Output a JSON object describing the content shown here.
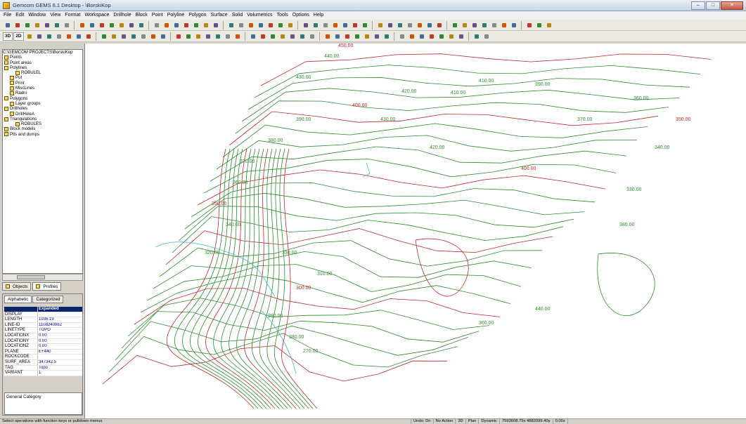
{
  "window": {
    "title": "Gemcom GEMS 6.1 Desktop - \\BorskiKop"
  },
  "menu": [
    "File",
    "Edit",
    "Window",
    "View",
    "Format",
    "Workspace",
    "Drillhole",
    "Block",
    "Point",
    "Polyline",
    "Polygon",
    "Surface",
    "Solid",
    "Volumetrics",
    "Tools",
    "Options",
    "Help"
  ],
  "toolbar2": {
    "view3d": "3D",
    "view2d": "2D"
  },
  "tree": {
    "root": "C:\\GEMCOM PROJECTS\\BorskiKop",
    "items": [
      {
        "label": "Points",
        "indent": 0
      },
      {
        "label": "Point areas",
        "indent": 0
      },
      {
        "label": "Polylines",
        "indent": 0
      },
      {
        "label": "ROBULEL",
        "indent": 2
      },
      {
        "label": "Put",
        "indent": 1
      },
      {
        "label": "Print",
        "indent": 1
      },
      {
        "label": "MiscLines",
        "indent": 1
      },
      {
        "label": "Radni",
        "indent": 1
      },
      {
        "label": "Polygons",
        "indent": 0
      },
      {
        "label": "Layer groups",
        "indent": 1
      },
      {
        "label": "Drillholes",
        "indent": 0
      },
      {
        "label": "DrillHoleA",
        "indent": 1
      },
      {
        "label": "Triangulations",
        "indent": 0
      },
      {
        "label": "ROBULES",
        "indent": 2
      },
      {
        "label": "Block models",
        "indent": 0
      },
      {
        "label": "Pits and dumps",
        "indent": 0
      }
    ]
  },
  "panel_tabs": {
    "objects": "Objects",
    "profiles": "Profiles"
  },
  "props_tabs": {
    "alphabetic": "Alphabetic",
    "categorized": "Categorized"
  },
  "props": [
    {
      "key": "",
      "value": "Expanded"
    },
    {
      "key": "DISPLAY",
      "value": ""
    },
    {
      "key": "LENGTH",
      "value": "1936.19"
    },
    {
      "key": "LINE-ID",
      "value": "1108240882"
    },
    {
      "key": "LINETYPE",
      "value": "TOPO"
    },
    {
      "key": "LOCATIONX",
      "value": "0.00"
    },
    {
      "key": "LOCATIONY",
      "value": "0.00"
    },
    {
      "key": "LOCATIONZ",
      "value": "0.00"
    },
    {
      "key": "PLANE",
      "value": "E+440"
    },
    {
      "key": "ROCKCODE",
      "value": ""
    },
    {
      "key": "SURF_AREA",
      "value": "347342.5"
    },
    {
      "key": "TAG",
      "value": "Topo"
    },
    {
      "key": "VARIANT",
      "value": "1"
    }
  ],
  "props_desc": "General Category",
  "status": {
    "message": "Select operations with function keys or pulldown menus",
    "undo": "Undo: Dn",
    "action": "No Action",
    "mode3d": "3D",
    "plan": "Plan",
    "dynamic": "Dynamic",
    "coords": "7593608.79x  4882099.40y",
    "z": "0.00z"
  },
  "contour_labels": [
    {
      "t": "450.00",
      "c": "red"
    },
    {
      "t": "440.00",
      "c": "green"
    },
    {
      "t": "430.00",
      "c": "green"
    },
    {
      "t": "420.00",
      "c": "green"
    },
    {
      "t": "410.00",
      "c": "green"
    },
    {
      "t": "400.00",
      "c": "red"
    },
    {
      "t": "390.00",
      "c": "green"
    },
    {
      "t": "380.00",
      "c": "green"
    },
    {
      "t": "370.00",
      "c": "green"
    },
    {
      "t": "360.00",
      "c": "green"
    },
    {
      "t": "350.00",
      "c": "red"
    },
    {
      "t": "340.00",
      "c": "green"
    },
    {
      "t": "330.00",
      "c": "green"
    },
    {
      "t": "320.00",
      "c": "green"
    },
    {
      "t": "310.00",
      "c": "green"
    },
    {
      "t": "300.00",
      "c": "red"
    },
    {
      "t": "290.00",
      "c": "green"
    },
    {
      "t": "280.00",
      "c": "green"
    },
    {
      "t": "270.00",
      "c": "green"
    },
    {
      "t": "410.00",
      "c": "green"
    },
    {
      "t": "390.00",
      "c": "green"
    },
    {
      "t": "370.00",
      "c": "green"
    },
    {
      "t": "360.00",
      "c": "green"
    },
    {
      "t": "350.00",
      "c": "red"
    },
    {
      "t": "340.00",
      "c": "green"
    },
    {
      "t": "330.00",
      "c": "green"
    },
    {
      "t": "380.00",
      "c": "green"
    },
    {
      "t": "400.00",
      "c": "red"
    },
    {
      "t": "420.00",
      "c": "green"
    },
    {
      "t": "430.00",
      "c": "green"
    },
    {
      "t": "440.00",
      "c": "green"
    },
    {
      "t": "360.00",
      "c": "green"
    }
  ],
  "colors": {
    "green": "#2e8b2e",
    "red": "#c0282b",
    "cyan": "#3bbcc8"
  }
}
